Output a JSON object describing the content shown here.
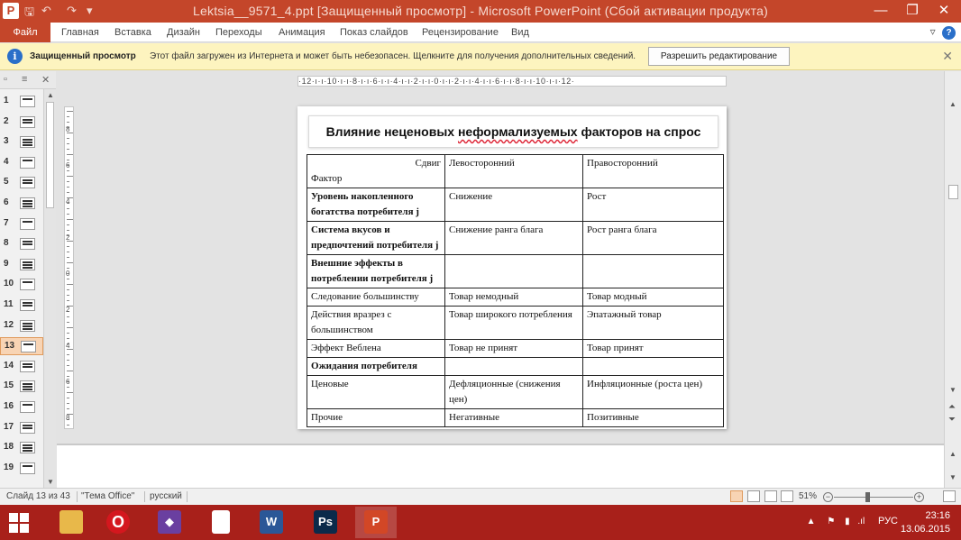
{
  "window": {
    "title": "Lektsia__9571_4.ppt [Защищенный просмотр] - Microsoft PowerPoint (Сбой активации продукта)",
    "app_icon_letter": "P",
    "qat_save": "🖫",
    "qat_undo": "↶",
    "qat_redo": "↷",
    "qat_more": "▾",
    "minimize": "—",
    "maximize": "❐",
    "close": "✕"
  },
  "ribbon": {
    "file_tab": "Файл",
    "tabs": [
      "Главная",
      "Вставка",
      "Дизайн",
      "Переходы",
      "Анимация",
      "Показ слайдов",
      "Рецензирование",
      "Вид"
    ],
    "collapse": "▿",
    "help": "?"
  },
  "message_bar": {
    "icon": "i",
    "title": "Защищенный просмотр",
    "text": "Этот файл загружен из Интернета и может быть небезопасен. Щелкните для получения дополнительных сведений.",
    "button": "Разрешить редактирование",
    "close": "✕"
  },
  "thumbnails": {
    "panel_buttons": [
      "▫",
      "≡",
      "✕"
    ],
    "slides": [
      "1",
      "2",
      "3",
      "4",
      "5",
      "6",
      "7",
      "8",
      "9",
      "10",
      "11",
      "12",
      "13",
      "14",
      "15",
      "16",
      "17",
      "18",
      "19"
    ],
    "active_index": 13
  },
  "ruler": {
    "text": "·12·ı·ı·10·ı·ı·8·ı·ı·6·ı·ı·4·ı·ı·2·ı·ı·0·ı·ı·2·ı·ı·4·ı·ı·6·ı·ı·8·ı·ı·10·ı·ı·12·"
  },
  "vruler_labels": [
    "8",
    "6",
    "4",
    "2",
    "0",
    "2",
    "4",
    "6",
    "8"
  ],
  "slide": {
    "title_pre": "Влияние неценовых ",
    "title_squig": "неформализуемых",
    "title_post": " факторов на спрос",
    "header": {
      "shift": "Сдвиг",
      "factor": "Фактор",
      "left": "Левосторонний",
      "right": "Правосторонний"
    },
    "rows": [
      {
        "factor": "Уровень  накопленного богатства потребителя j",
        "left": "Снижение",
        "right": "Рост",
        "bold": true
      },
      {
        "factor": "Система  вкусов и предпочтений потребителя j",
        "left": "Снижение ранга блага",
        "right": "Рост ранга блага",
        "bold": true
      },
      {
        "factor": "Внешние эффекты в потреблении потребителя j",
        "left": "",
        "right": "",
        "bold": true
      },
      {
        "factor": "Следование большинству",
        "left": "Товар немодный",
        "right": "Товар модный",
        "bold": false
      },
      {
        "factor": "Действия вразрез с большинством",
        "left": "Товар широкого потребления",
        "right": "Эпатажный  товар",
        "bold": false
      },
      {
        "factor": "Эффект Веблена",
        "left": "Товар не принят",
        "right": "Товар принят",
        "bold": false
      },
      {
        "factor": "Ожидания потребителя",
        "left": "",
        "right": "",
        "bold": true
      },
      {
        "factor": "Ценовые",
        "left": "Дефляционные (снижения цен)",
        "right": "Инфляционные (роста цен)",
        "bold": false
      },
      {
        "factor": "Прочие",
        "left": "Негативные",
        "right": "Позитивные",
        "bold": false
      }
    ]
  },
  "statusbar": {
    "slide_info": "Слайд 13 из 43",
    "theme": "\"Тема Office\"",
    "language": "русский",
    "zoom": "51%",
    "zoom_minus": "−",
    "zoom_plus": "+"
  },
  "taskbar": {
    "apps": [
      {
        "name": "file-explorer",
        "label": "",
        "color": "#e8b84a"
      },
      {
        "name": "opera",
        "label": "O",
        "color": "#d4171e"
      },
      {
        "name": "visual-studio",
        "label": "◆",
        "color": "#6a3fa0"
      },
      {
        "name": "document",
        "label": "",
        "color": "#ffffff"
      },
      {
        "name": "word",
        "label": "W",
        "color": "#2b5797"
      },
      {
        "name": "photoshop",
        "label": "Ps",
        "color": "#0b2a4a"
      },
      {
        "name": "powerpoint",
        "label": "P",
        "color": "#d24726"
      }
    ],
    "tray_language": "РУС",
    "time": "23:16",
    "date": "13.06.2015"
  }
}
